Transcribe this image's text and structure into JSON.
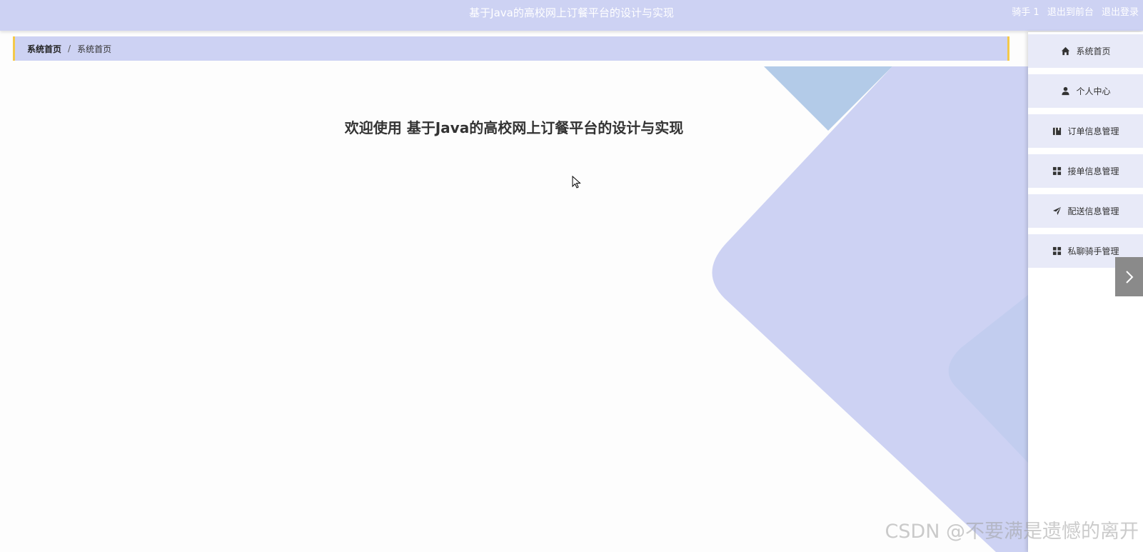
{
  "header": {
    "title": "基于Java的高校网上订餐平台的设计与实现",
    "user": "骑手 1",
    "to_front": "退出到前台",
    "logout": "退出登录"
  },
  "breadcrumb": {
    "home": "系统首页",
    "separator": "/",
    "current": "系统首页"
  },
  "main": {
    "welcome": "欢迎使用 基于Java的高校网上订餐平台的设计与实现"
  },
  "sidebar": {
    "items": [
      {
        "label": "系统首页",
        "icon": "home-icon"
      },
      {
        "label": "个人中心",
        "icon": "user-icon"
      },
      {
        "label": "订单信息管理",
        "icon": "book-icon"
      },
      {
        "label": "接单信息管理",
        "icon": "grid-icon"
      },
      {
        "label": "配送信息管理",
        "icon": "paper-plane-icon"
      },
      {
        "label": "私聊骑手管理",
        "icon": "grid-icon"
      }
    ]
  },
  "watermark": "CSDN @不要满是遗憾的离开",
  "colors": {
    "header_bg": "#cdd2f3",
    "accent": "#f4c94a",
    "menu_bg": "#e8eaf8",
    "decor": "#cdd2f3",
    "decor_secondary": "#b3cbe8"
  }
}
